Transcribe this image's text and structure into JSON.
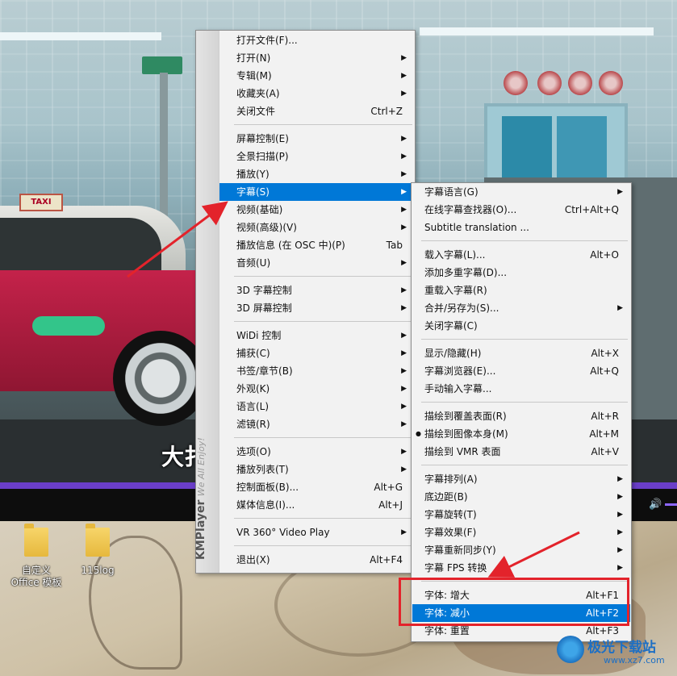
{
  "video": {
    "subtitle": "大扌"
  },
  "desktop": {
    "icons": [
      "自定义 Office 模板",
      "115log"
    ]
  },
  "brand": {
    "name": "KMPlayer",
    "tagline": "We All Enjoy!"
  },
  "main_menu": [
    {
      "label": "打开文件(F)...",
      "shortcut": "",
      "arrow": false
    },
    {
      "label": "打开(N)",
      "shortcut": "",
      "arrow": true
    },
    {
      "label": "专辑(M)",
      "shortcut": "",
      "arrow": true
    },
    {
      "label": "收藏夹(A)",
      "shortcut": "",
      "arrow": true
    },
    {
      "label": "关闭文件",
      "shortcut": "Ctrl+Z",
      "arrow": false
    },
    {
      "label": "屏幕控制(E)",
      "shortcut": "",
      "arrow": true
    },
    {
      "label": "全景扫描(P)",
      "shortcut": "",
      "arrow": true
    },
    {
      "label": "播放(Y)",
      "shortcut": "",
      "arrow": true
    },
    {
      "label": "字幕(S)",
      "shortcut": "",
      "arrow": true,
      "highlighted": true
    },
    {
      "label": "视频(基础)",
      "shortcut": "",
      "arrow": true
    },
    {
      "label": "视频(高级)(V)",
      "shortcut": "",
      "arrow": true
    },
    {
      "label": "播放信息 (在 OSC 中)(P)",
      "shortcut": "Tab",
      "arrow": false
    },
    {
      "label": "音频(U)",
      "shortcut": "",
      "arrow": true
    },
    {
      "label": "3D 字幕控制",
      "shortcut": "",
      "arrow": true
    },
    {
      "label": "3D 屏幕控制",
      "shortcut": "",
      "arrow": true
    },
    {
      "label": "WiDi 控制",
      "shortcut": "",
      "arrow": true
    },
    {
      "label": "捕获(C)",
      "shortcut": "",
      "arrow": true
    },
    {
      "label": "书签/章节(B)",
      "shortcut": "",
      "arrow": true
    },
    {
      "label": "外观(K)",
      "shortcut": "",
      "arrow": true
    },
    {
      "label": "语言(L)",
      "shortcut": "",
      "arrow": true
    },
    {
      "label": "滤镜(R)",
      "shortcut": "",
      "arrow": true
    },
    {
      "label": "选项(O)",
      "shortcut": "",
      "arrow": true
    },
    {
      "label": "播放列表(T)",
      "shortcut": "",
      "arrow": true
    },
    {
      "label": "控制面板(B)...",
      "shortcut": "Alt+G",
      "arrow": false
    },
    {
      "label": "媒体信息(I)...",
      "shortcut": "Alt+J",
      "arrow": false
    },
    {
      "label": "VR 360° Video Play",
      "shortcut": "",
      "arrow": true
    },
    {
      "label": "退出(X)",
      "shortcut": "Alt+F4",
      "arrow": false
    }
  ],
  "sub_menu": [
    {
      "label": "字幕语言(G)",
      "shortcut": "",
      "arrow": true
    },
    {
      "label": "在线字幕查找器(O)...",
      "shortcut": "Ctrl+Alt+Q",
      "arrow": false
    },
    {
      "label": "Subtitle translation ...",
      "shortcut": "",
      "arrow": false
    },
    {
      "label": "载入字幕(L)...",
      "shortcut": "Alt+O",
      "arrow": false
    },
    {
      "label": "添加多重字幕(D)...",
      "shortcut": "",
      "arrow": false
    },
    {
      "label": "重载入字幕(R)",
      "shortcut": "",
      "arrow": false
    },
    {
      "label": "合并/另存为(S)...",
      "shortcut": "",
      "arrow": true
    },
    {
      "label": "关闭字幕(C)",
      "shortcut": "",
      "arrow": false
    },
    {
      "label": "显示/隐藏(H)",
      "shortcut": "Alt+X",
      "arrow": false
    },
    {
      "label": "字幕浏览器(E)...",
      "shortcut": "Alt+Q",
      "arrow": false
    },
    {
      "label": "手动输入字幕...",
      "shortcut": "",
      "arrow": false
    },
    {
      "label": "描绘到覆盖表面(R)",
      "shortcut": "Alt+R",
      "arrow": false
    },
    {
      "label": "描绘到图像本身(M)",
      "shortcut": "Alt+M",
      "arrow": false,
      "checked": true
    },
    {
      "label": "描绘到 VMR 表面",
      "shortcut": "Alt+V",
      "arrow": false
    },
    {
      "label": "字幕排列(A)",
      "shortcut": "",
      "arrow": true
    },
    {
      "label": "底边距(B)",
      "shortcut": "",
      "arrow": true
    },
    {
      "label": "字幕旋转(T)",
      "shortcut": "",
      "arrow": true
    },
    {
      "label": "字幕效果(F)",
      "shortcut": "",
      "arrow": true
    },
    {
      "label": "字幕重新同步(Y)",
      "shortcut": "",
      "arrow": true
    },
    {
      "label": "字幕 FPS 转换",
      "shortcut": "",
      "arrow": true
    },
    {
      "label": "字体: 增大",
      "shortcut": "Alt+F1",
      "arrow": false
    },
    {
      "label": "字体: 减小",
      "shortcut": "Alt+F2",
      "arrow": false,
      "highlighted": true
    },
    {
      "label": "字体: 重置",
      "shortcut": "Alt+F3",
      "arrow": false
    }
  ],
  "watermark": {
    "text": "极光下载站",
    "url": "www.xz7.com"
  },
  "colors": {
    "highlight": "#0078d7",
    "annotation": "#e3232b",
    "progress": "#6a3ec8"
  }
}
